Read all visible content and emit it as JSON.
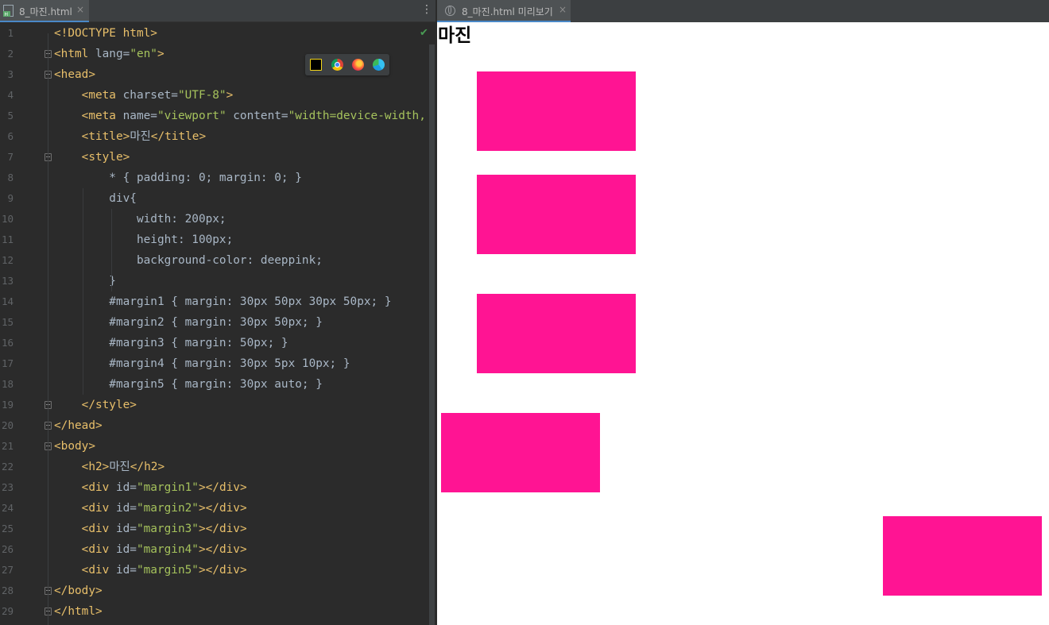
{
  "editor": {
    "tab_label": "8_마진.html",
    "tab_close": "×",
    "menu_glyph": "⋮",
    "check_glyph": "✔",
    "lines": [
      {
        "n": "1",
        "html": "<span class=\"tag\">&lt;!DOCTYPE html&gt;</span>"
      },
      {
        "n": "2",
        "html": "<span class=\"tag\">&lt;html </span>lang=<span class=\"str\">\"en\"</span><span class=\"tag\">&gt;</span>"
      },
      {
        "n": "3",
        "html": "<span class=\"tag\">&lt;head&gt;</span>"
      },
      {
        "n": "4",
        "html": "    <span class=\"tag\">&lt;meta </span>charset=<span class=\"str\">\"UTF-8\"</span><span class=\"tag\">&gt;</span>"
      },
      {
        "n": "5",
        "html": "    <span class=\"tag\">&lt;meta </span>name=<span class=\"str\">\"viewport\"</span> content=<span class=\"str\">\"width=device-width,</span>"
      },
      {
        "n": "6",
        "html": "    <span class=\"tag\">&lt;title&gt;</span>마진<span class=\"tag\">&lt;/title&gt;</span>"
      },
      {
        "n": "7",
        "html": "    <span class=\"tag\">&lt;style&gt;</span>"
      },
      {
        "n": "8",
        "html": "        * { padding: 0; margin: 0; }"
      },
      {
        "n": "9",
        "html": "        div{"
      },
      {
        "n": "10",
        "html": "            width: 200px;"
      },
      {
        "n": "11",
        "html": "            height: 100px;"
      },
      {
        "n": "12",
        "html": "            background-color: deeppink;"
      },
      {
        "n": "13",
        "html": "        }"
      },
      {
        "n": "14",
        "html": "        #margin1 { margin: 30px 50px 30px 50px; }"
      },
      {
        "n": "15",
        "html": "        #margin2 { margin: 30px 50px; }"
      },
      {
        "n": "16",
        "html": "        #margin3 { margin: 50px; }"
      },
      {
        "n": "17",
        "html": "        #margin4 { margin: 30px 5px 10px; }"
      },
      {
        "n": "18",
        "html": "        #margin5 { margin: 30px auto; }"
      },
      {
        "n": "19",
        "html": "    <span class=\"tag\">&lt;/style&gt;</span>"
      },
      {
        "n": "20",
        "html": "<span class=\"tag\">&lt;/head&gt;</span>"
      },
      {
        "n": "21",
        "html": "<span class=\"tag\">&lt;body&gt;</span>"
      },
      {
        "n": "22",
        "html": "    <span class=\"tag\">&lt;h2&gt;</span>마진<span class=\"tag\">&lt;/h2&gt;</span>"
      },
      {
        "n": "23",
        "html": "    <span class=\"tag\">&lt;div </span>id=<span class=\"str\">\"margin1\"</span><span class=\"tag\">&gt;&lt;/div&gt;</span>"
      },
      {
        "n": "24",
        "html": "    <span class=\"tag\">&lt;div </span>id=<span class=\"str\">\"margin2\"</span><span class=\"tag\">&gt;&lt;/div&gt;</span>"
      },
      {
        "n": "25",
        "html": "    <span class=\"tag\">&lt;div </span>id=<span class=\"str\">\"margin3\"</span><span class=\"tag\">&gt;&lt;/div&gt;</span>"
      },
      {
        "n": "26",
        "html": "    <span class=\"tag\">&lt;div </span>id=<span class=\"str\">\"margin4\"</span><span class=\"tag\">&gt;&lt;/div&gt;</span>"
      },
      {
        "n": "27",
        "html": "    <span class=\"tag\">&lt;div </span>id=<span class=\"str\">\"margin5\"</span><span class=\"tag\">&gt;&lt;/div&gt;</span>"
      },
      {
        "n": "28",
        "html": "<span class=\"tag\">&lt;/body&gt;</span>"
      },
      {
        "n": "29",
        "html": "<span class=\"tag\">&lt;/html&gt;</span>"
      }
    ],
    "browser_icons": [
      "pycharm-icon",
      "chrome-icon",
      "firefox-icon",
      "edge-icon"
    ]
  },
  "preview": {
    "tab_label": "8_마진.html 미리보기",
    "tab_close": "×",
    "heading": "마진",
    "box_color": "#ff1493",
    "boxes": [
      "margin1",
      "margin2",
      "margin3",
      "margin4",
      "margin5"
    ]
  }
}
